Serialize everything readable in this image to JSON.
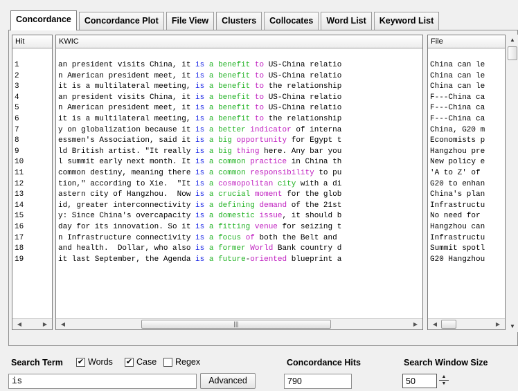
{
  "tabs": [
    "Concordance",
    "Concordance Plot",
    "File View",
    "Clusters",
    "Collocates",
    "Word List",
    "Keyword List"
  ],
  "active_tab": 0,
  "columns": {
    "hit": "Hit",
    "kwic": "KWIC",
    "file": "File"
  },
  "rows": [
    {
      "hit": "1",
      "pre": "an president visits China, it ",
      "kw": "is",
      "w1": "a",
      "w2": "benefit",
      "w3": "to",
      "post": " US-China relatio",
      "c1": "c1",
      "c2": "c1",
      "c3": "c2",
      "file": "China can le"
    },
    {
      "hit": "2",
      "pre": "n American president meet, it ",
      "kw": "is",
      "w1": "a",
      "w2": "benefit",
      "w3": "to",
      "post": " US-China relatio",
      "c1": "c1",
      "c2": "c1",
      "c3": "c2",
      "file": "China can le"
    },
    {
      "hit": "3",
      "pre": "it is a multilateral meeting, ",
      "kw": "is",
      "w1": "a",
      "w2": "benefit",
      "w3": "to",
      "post": " the relationship",
      "c1": "c1",
      "c2": "c1",
      "c3": "c2",
      "file": "China can le"
    },
    {
      "hit": "4",
      "pre": "an president visits China, it ",
      "kw": "is",
      "w1": "a",
      "w2": "benefit",
      "w3": "to",
      "post": " US-China relatio",
      "c1": "c1",
      "c2": "c1",
      "c3": "c2",
      "file": "F---China ca"
    },
    {
      "hit": "5",
      "pre": "n American president meet, it ",
      "kw": "is",
      "w1": "a",
      "w2": "benefit",
      "w3": "to",
      "post": " US-China relatio",
      "c1": "c1",
      "c2": "c1",
      "c3": "c2",
      "file": "F---China ca"
    },
    {
      "hit": "6",
      "pre": "it is a multilateral meeting, ",
      "kw": "is",
      "w1": "a",
      "w2": "benefit",
      "w3": "to",
      "post": " the relationship",
      "c1": "c1",
      "c2": "c1",
      "c3": "c2",
      "file": "F---China ca"
    },
    {
      "hit": "7",
      "pre": "y on globalization because it ",
      "kw": "is",
      "w1": "a",
      "w2": "better",
      "w3": "indicator",
      "post": " of interna",
      "c1": "c1",
      "c2": "c1",
      "c3": "c2",
      "file": "China, G20 m"
    },
    {
      "hit": "8",
      "pre": "essmen's Association, said it ",
      "kw": "is",
      "w1": "a",
      "w2": "big",
      "w3": "opportunity",
      "post": " for Egypt t",
      "c1": "c1",
      "c2": "c1",
      "c3": "c2",
      "file": "Economists p"
    },
    {
      "hit": "9",
      "pre": "ld British artist. \"It really ",
      "kw": "is",
      "w1": "a",
      "w2": "big",
      "w3": "thing",
      "post": " here. Any bar you",
      "c1": "c1",
      "c2": "c1",
      "c3": "c2",
      "file": "Hangzhou pre"
    },
    {
      "hit": "10",
      "pre": "l summit early next month. It ",
      "kw": "is",
      "w1": "a",
      "w2": "common",
      "w3": "practice",
      "post": " in China th",
      "c1": "c1",
      "c2": "c1",
      "c3": "c2",
      "file": "New policy e"
    },
    {
      "hit": "11",
      "pre": "common destiny, meaning there ",
      "kw": "is",
      "w1": "a",
      "w2": "common",
      "w3": "responsibility",
      "post": " to pu",
      "c1": "c1",
      "c2": "c1",
      "c3": "c2",
      "file": "'A to Z' of"
    },
    {
      "hit": "12",
      "pre": "tion,\" according to Xie.  \"It ",
      "kw": "is",
      "w1": "a",
      "w2": "cosmopolitan",
      "w3": "city",
      "post": " with a di",
      "c1": "c1",
      "c2": "c2",
      "c3": "c1",
      "file": "G20 to enhan"
    },
    {
      "hit": "13",
      "pre": "astern city of Hangzhou.  Now ",
      "kw": "is",
      "w1": "a",
      "w2": "crucial",
      "w3": "moment",
      "post": " for the glob",
      "c1": "c1",
      "c2": "c1",
      "c3": "c2",
      "file": "China's plan"
    },
    {
      "hit": "14",
      "pre": "id, greater interconnectivity ",
      "kw": "is",
      "w1": "a",
      "w2": "defining",
      "w3": "demand",
      "post": " of the 21st",
      "c1": "c1",
      "c2": "c1",
      "c3": "c2",
      "file": "Infrastructu"
    },
    {
      "hit": "15",
      "pre": "y: Since China's overcapacity ",
      "kw": "is",
      "w1": "a",
      "w2": "domestic",
      "w3": "issue",
      "post": ", it should b",
      "c1": "c1",
      "c2": "c1",
      "c3": "c2",
      "file": "No need for"
    },
    {
      "hit": "16",
      "pre": "day for its innovation. So it ",
      "kw": "is",
      "w1": "a",
      "w2": "fitting",
      "w3": "venue",
      "post": " for seizing t",
      "c1": "c1",
      "c2": "c1",
      "c3": "c2",
      "file": "Hangzhou can"
    },
    {
      "hit": "17",
      "pre": "n Infrastructure connectivity ",
      "kw": "is",
      "w1": "a",
      "w2": "focus",
      "w3": "of",
      "post": " both the Belt and",
      "c1": "c1",
      "c2": "c1",
      "c3": "c2",
      "file": "Infrastructu"
    },
    {
      "hit": "18",
      "pre": "and health.  Dollar, who also ",
      "kw": "is",
      "w1": "a",
      "w2": "former",
      "w3": "World",
      "post": " Bank country d",
      "c1": "c1",
      "c2": "c1",
      "c3": "c2",
      "file": "Summit spotl"
    },
    {
      "hit": "19",
      "pre": "it last September, the Agenda ",
      "kw": "is",
      "w1": "a",
      "w2": "future",
      "w3": "oriented",
      "post": " blueprint a",
      "c1": "c1",
      "c2": "c1",
      "c3": "c2",
      "joiner": "-",
      "file": "G20 Hangzhou"
    }
  ],
  "search": {
    "term_label": "Search Term",
    "words_label": "Words",
    "words": true,
    "case_label": "Case",
    "case": true,
    "regex_label": "Regex",
    "regex": false,
    "term_value": "is",
    "advanced_label": "Advanced"
  },
  "hits": {
    "label": "Concordance Hits",
    "value": "790"
  },
  "window": {
    "label": "Search Window Size",
    "value": "50"
  },
  "colors": {
    "node": "#1a26e6",
    "collocate_1": "#22b224",
    "collocate_2": "#c020c0"
  }
}
